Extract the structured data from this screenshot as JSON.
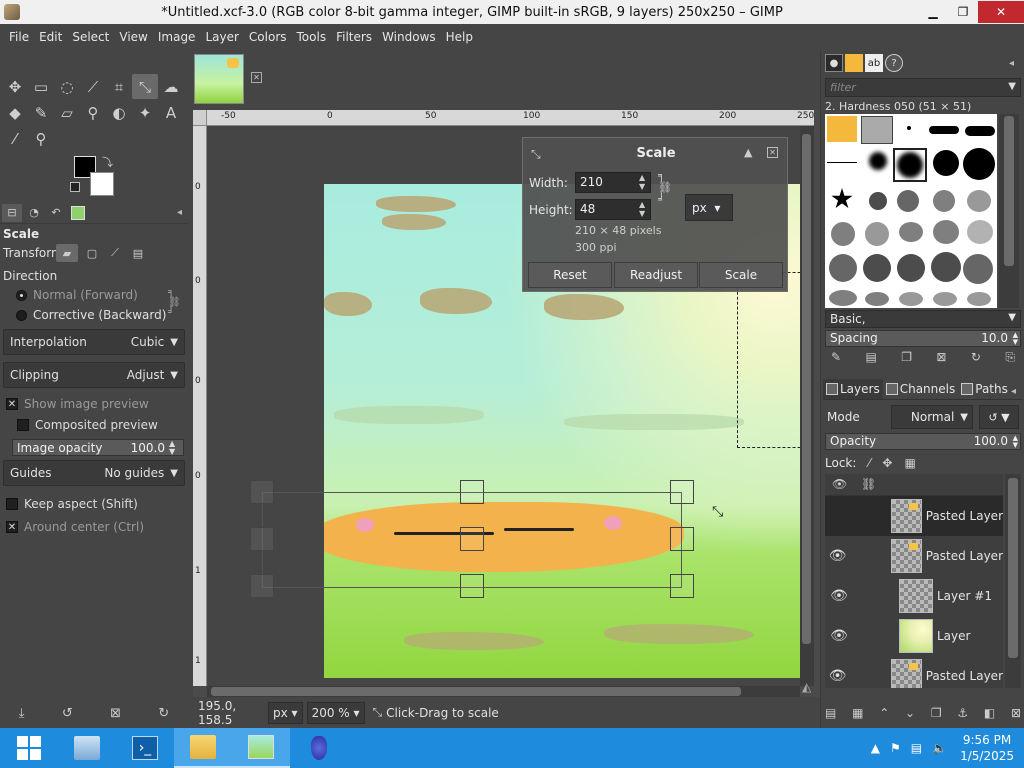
{
  "window": {
    "title": "*Untitled.xcf-3.0 (RGB color 8-bit gamma integer, GIMP built-in sRGB, 9 layers) 250x250 – GIMP",
    "minimize": "▁",
    "restore": "❐",
    "close": "✕"
  },
  "menubar": [
    "File",
    "Edit",
    "Select",
    "View",
    "Image",
    "Layer",
    "Colors",
    "Tools",
    "Filters",
    "Windows",
    "Help"
  ],
  "tool_options": {
    "title": "Scale",
    "transform_label": "Transform:",
    "direction_label": "Direction",
    "direction_normal": "Normal (Forward)",
    "direction_corrective": "Corrective (Backward)",
    "interpolation_label": "Interpolation",
    "interpolation_value": "Cubic",
    "clipping_label": "Clipping",
    "clipping_value": "Adjust",
    "show_preview": "Show image preview",
    "composited_preview": "Composited preview",
    "image_opacity_label": "Image opacity",
    "image_opacity_value": "100.0",
    "guides_label": "Guides",
    "guides_value": "No guides",
    "keep_aspect": "Keep aspect (Shift)",
    "around_center": "Around center (Ctrl)"
  },
  "ruler": {
    "h_ticks": [
      "-50",
      "0",
      "50",
      "100",
      "150",
      "200",
      "250"
    ],
    "v_ticks": [
      "0",
      "0",
      "0",
      "0",
      "1",
      "1"
    ]
  },
  "scale_dialog": {
    "title": "Scale",
    "width_label": "Width:",
    "width_value": "210",
    "height_label": "Height:",
    "height_value": "48",
    "unit": "px",
    "size_info": "210 × 48 pixels",
    "resolution_info": "300 ppi",
    "reset": "Reset",
    "readjust": "Readjust",
    "scale": "Scale"
  },
  "statusbar": {
    "coords": "195.0, 158.5",
    "unit": "px",
    "zoom": "200 %",
    "hint": "Click-Drag to scale"
  },
  "brushes": {
    "filter_placeholder": "filter",
    "current": "2. Hardness 050 (51 × 51)",
    "tag": "Basic,",
    "spacing_label": "Spacing",
    "spacing_value": "10.0"
  },
  "layers_panel": {
    "tab_layers": "Layers",
    "tab_channels": "Channels",
    "tab_paths": "Paths",
    "mode_label": "Mode",
    "mode_value": "Normal",
    "opacity_label": "Opacity",
    "opacity_value": "100.0",
    "lock_label": "Lock:",
    "layers": [
      {
        "name": "Pasted Layer",
        "visible": false,
        "selected": true
      },
      {
        "name": "Pasted Layer",
        "visible": true,
        "selected": false
      },
      {
        "name": "Layer #1",
        "visible": true,
        "selected": false
      },
      {
        "name": "Layer",
        "visible": true,
        "selected": false
      },
      {
        "name": "Pasted Layer",
        "visible": true,
        "selected": false
      }
    ]
  },
  "taskbar": {
    "time": "9:56 PM",
    "date": "1/5/2025"
  },
  "colors": {
    "accent": "#1f8bdc",
    "close_red": "#c1292e",
    "panel_bg": "#454545"
  }
}
